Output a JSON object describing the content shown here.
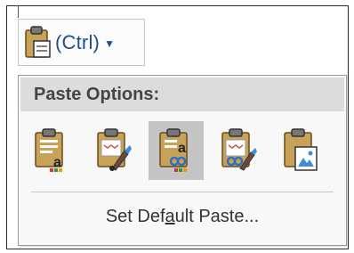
{
  "button": {
    "label": "(Ctrl)",
    "caret_icon": "chevron-down-icon",
    "icon": "clipboard-paste-icon"
  },
  "menu": {
    "header": "Paste Options:",
    "options": [
      {
        "icon": "keep-source-formatting-icon",
        "selected": false
      },
      {
        "icon": "merge-formatting-icon",
        "selected": false
      },
      {
        "icon": "use-destination-styles-icon",
        "selected": true
      },
      {
        "icon": "keep-text-only-formatting-icon",
        "selected": false
      },
      {
        "icon": "picture-icon",
        "selected": false
      }
    ],
    "set_default_pre": "Set Def",
    "set_default_access": "a",
    "set_default_post": "ult Paste..."
  },
  "colors": {
    "button_text": "#1e4e8c",
    "clipboard_body": "#c9a25a",
    "clipboard_clip": "#6b6b6b",
    "header_bg": "#dcdcdc",
    "selected_bg": "#c4c4c4"
  }
}
